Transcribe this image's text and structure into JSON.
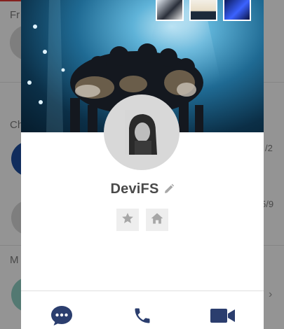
{
  "background": {
    "section_friends": "Fr",
    "section_chats": "Ch",
    "section_more": "M",
    "date_1": "/2",
    "date_2": "5/9"
  },
  "profile": {
    "name": "DeviFS",
    "icons": {
      "edit": "pencil-icon",
      "favorite": "star-icon",
      "home": "home-icon"
    }
  },
  "actions": [
    {
      "name": "chat",
      "icon": "chat-bubble-icon"
    },
    {
      "name": "call",
      "icon": "phone-icon"
    },
    {
      "name": "video",
      "icon": "video-camera-icon"
    }
  ],
  "colors": {
    "accent": "#2b3e6e",
    "icon_gray": "#a7a7a7",
    "name_text": "#4a4a4a"
  }
}
